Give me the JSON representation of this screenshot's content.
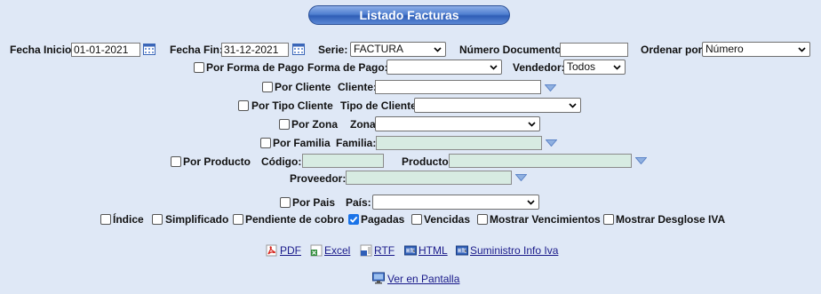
{
  "title": "Listado Facturas",
  "fecha_inicio": {
    "label": "Fecha Inicio:",
    "value": "01-01-2021"
  },
  "fecha_fin": {
    "label": "Fecha Fin:",
    "value": "31-12-2021"
  },
  "serie": {
    "label": "Serie:",
    "value": "FACTURA"
  },
  "numero_documento": {
    "label": "Número Documento:",
    "value": ""
  },
  "ordenar_por": {
    "label": "Ordenar por:",
    "value": "Número"
  },
  "forma_pago": {
    "check_label": "Por Forma de Pago",
    "label": "Forma de Pago:",
    "value": ""
  },
  "vendedor": {
    "label": "Vendedor:",
    "value": "Todos"
  },
  "cliente": {
    "check_label": "Por Cliente",
    "label": "Cliente:",
    "value": ""
  },
  "tipo_cliente": {
    "check_label": "Por Tipo Cliente",
    "label": "Tipo de Cliente",
    "value": ""
  },
  "zona": {
    "check_label": "Por Zona",
    "label": "Zona",
    "value": ""
  },
  "familia": {
    "check_label": "Por Familia",
    "label": "Familia:",
    "value": ""
  },
  "producto": {
    "check_label": "Por Producto",
    "codigo_label": "Código:",
    "label": "Producto:",
    "codigo_value": "",
    "value": ""
  },
  "proveedor": {
    "label": "Proveedor:",
    "value": ""
  },
  "pais": {
    "check_label": "Por Pais",
    "label": "País:",
    "value": ""
  },
  "options": {
    "indice": {
      "label": "Índice",
      "checked": false
    },
    "simplificado": {
      "label": "Simplificado",
      "checked": false
    },
    "pendiente": {
      "label": "Pendiente de cobro",
      "checked": false
    },
    "pagadas": {
      "label": "Pagadas",
      "checked": true
    },
    "vencidas": {
      "label": "Vencidas",
      "checked": false
    },
    "vencimientos": {
      "label": "Mostrar Vencimientos",
      "checked": false
    },
    "iva": {
      "label": "Mostrar Desglose IVA",
      "checked": false
    }
  },
  "exports": {
    "pdf": "PDF",
    "excel": "Excel",
    "rtf": "RTF",
    "html": "HTML",
    "suministro": "Suministro Info Iva"
  },
  "ver_pantalla": "Ver en Pantalla",
  "colors": {
    "title_blue": "#3f6cc4",
    "field_green": "#d7ebe2",
    "page_bg": "#dfe8f6",
    "check_blue": "#1a73e8"
  }
}
